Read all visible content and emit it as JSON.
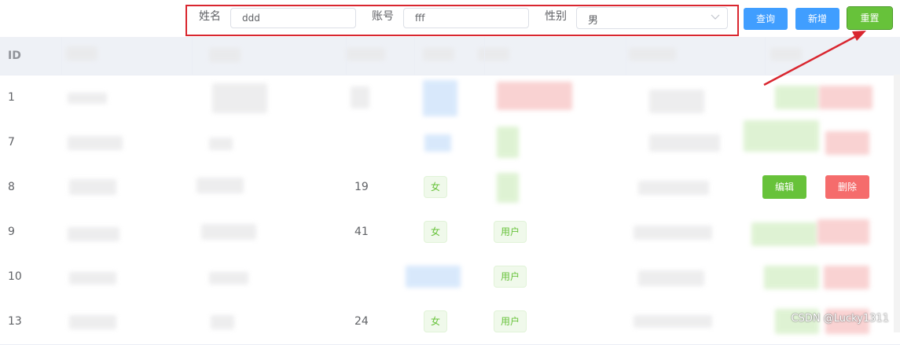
{
  "search": {
    "name_label": "姓名",
    "name_value": "ddd",
    "account_label": "账号",
    "account_value": "fff",
    "sex_label": "性别",
    "sex_value": "男",
    "query_btn": "查询",
    "add_btn": "新增",
    "reset_btn": "重置"
  },
  "table": {
    "id_header": "ID",
    "rows": [
      {
        "id": "1",
        "age": "",
        "sex": "",
        "role": "",
        "edit": "",
        "del": ""
      },
      {
        "id": "7",
        "age": "",
        "sex": "",
        "role": "",
        "edit": "",
        "del": ""
      },
      {
        "id": "8",
        "age": "19",
        "sex": "女",
        "role": "",
        "edit": "编辑",
        "del": "删除"
      },
      {
        "id": "9",
        "age": "41",
        "sex": "女",
        "role": "用户",
        "edit": "",
        "del": ""
      },
      {
        "id": "10",
        "age": "",
        "sex": "",
        "role": "用户",
        "edit": "",
        "del": ""
      },
      {
        "id": "13",
        "age": "24",
        "sex": "女",
        "role": "用户",
        "edit": "",
        "del": ""
      }
    ]
  },
  "watermark": "CSDN @Lucky1311",
  "colors": {
    "primary": "#409eff",
    "success": "#67c23a",
    "danger": "#f56c6c",
    "highlight_frame": "#d9262f",
    "arrow": "#d9262f"
  }
}
